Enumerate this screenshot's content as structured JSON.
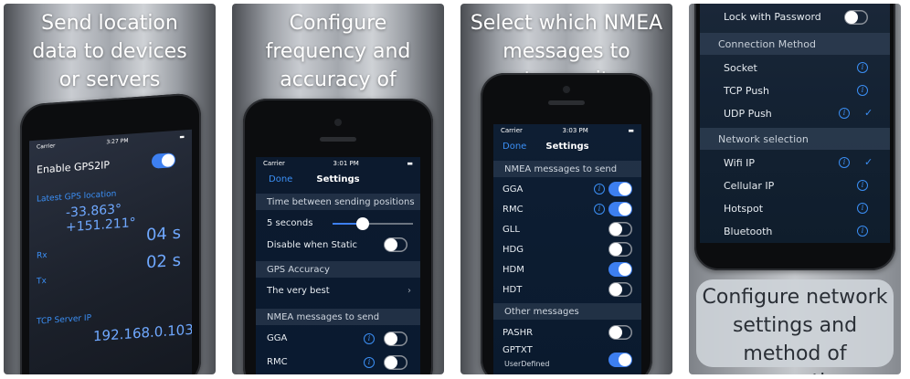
{
  "panels": [
    {
      "caption": "Send location data to devices or servers",
      "status": {
        "carrier": "Carrier",
        "time": "3:27 PM"
      },
      "enable_label": "Enable GPS2IP",
      "latest_label": "Latest GPS location",
      "coords": "-33.863° +151.211°",
      "value_a": "04 s",
      "value_b": "02 s",
      "label_a": "Rx",
      "label_b": "Tx",
      "server_label": "TCP Server IP",
      "server_ip": "192.168.0.103"
    },
    {
      "caption": "Configure frequency and accuracy of transmissions",
      "status": {
        "carrier": "Carrier",
        "time": "3:01 PM"
      },
      "nav": {
        "done": "Done",
        "title": "Settings"
      },
      "section_time": "Time between sending positions",
      "seconds": "5 seconds",
      "slider_fraction": 0.37,
      "disable_static": "Disable when Static",
      "section_accuracy": "GPS Accuracy",
      "accuracy_value": "The very best",
      "section_nmea": "NMEA messages to send",
      "gga": "GGA",
      "rmc": "RMC"
    },
    {
      "caption": "Select which NMEA messages to transmit",
      "status": {
        "carrier": "Carrier",
        "time": "3:03 PM"
      },
      "nav": {
        "done": "Done",
        "title": "Settings"
      },
      "section_nmea": "NMEA messages to send",
      "messages": [
        {
          "label": "GGA",
          "info": true,
          "on": true
        },
        {
          "label": "RMC",
          "info": true,
          "on": true
        },
        {
          "label": "GLL",
          "info": false,
          "on": false
        },
        {
          "label": "HDG",
          "info": false,
          "on": false
        },
        {
          "label": "HDM",
          "info": false,
          "on": true
        },
        {
          "label": "HDT",
          "info": false,
          "on": false
        }
      ],
      "section_other": "Other messages",
      "pashr": "PASHR",
      "gptxt": "GPTXT",
      "gptxt_sub": "UserDefined"
    },
    {
      "caption": "Configure network settings and method of connection",
      "lock_label": "Lock with Password",
      "section_connection": "Connection Method",
      "connection": [
        {
          "label": "Socket",
          "checked": false
        },
        {
          "label": "TCP Push",
          "checked": false
        },
        {
          "label": "UDP Push",
          "checked": true
        }
      ],
      "section_network": "Network selection",
      "network": [
        {
          "label": "Wifi IP",
          "checked": true
        },
        {
          "label": "Cellular IP",
          "checked": false
        },
        {
          "label": "Hotspot",
          "checked": false
        },
        {
          "label": "Bluetooth",
          "checked": false
        }
      ]
    }
  ],
  "colors": {
    "accent": "#3b8ff5",
    "toggle_on": "#3d7ff0"
  }
}
